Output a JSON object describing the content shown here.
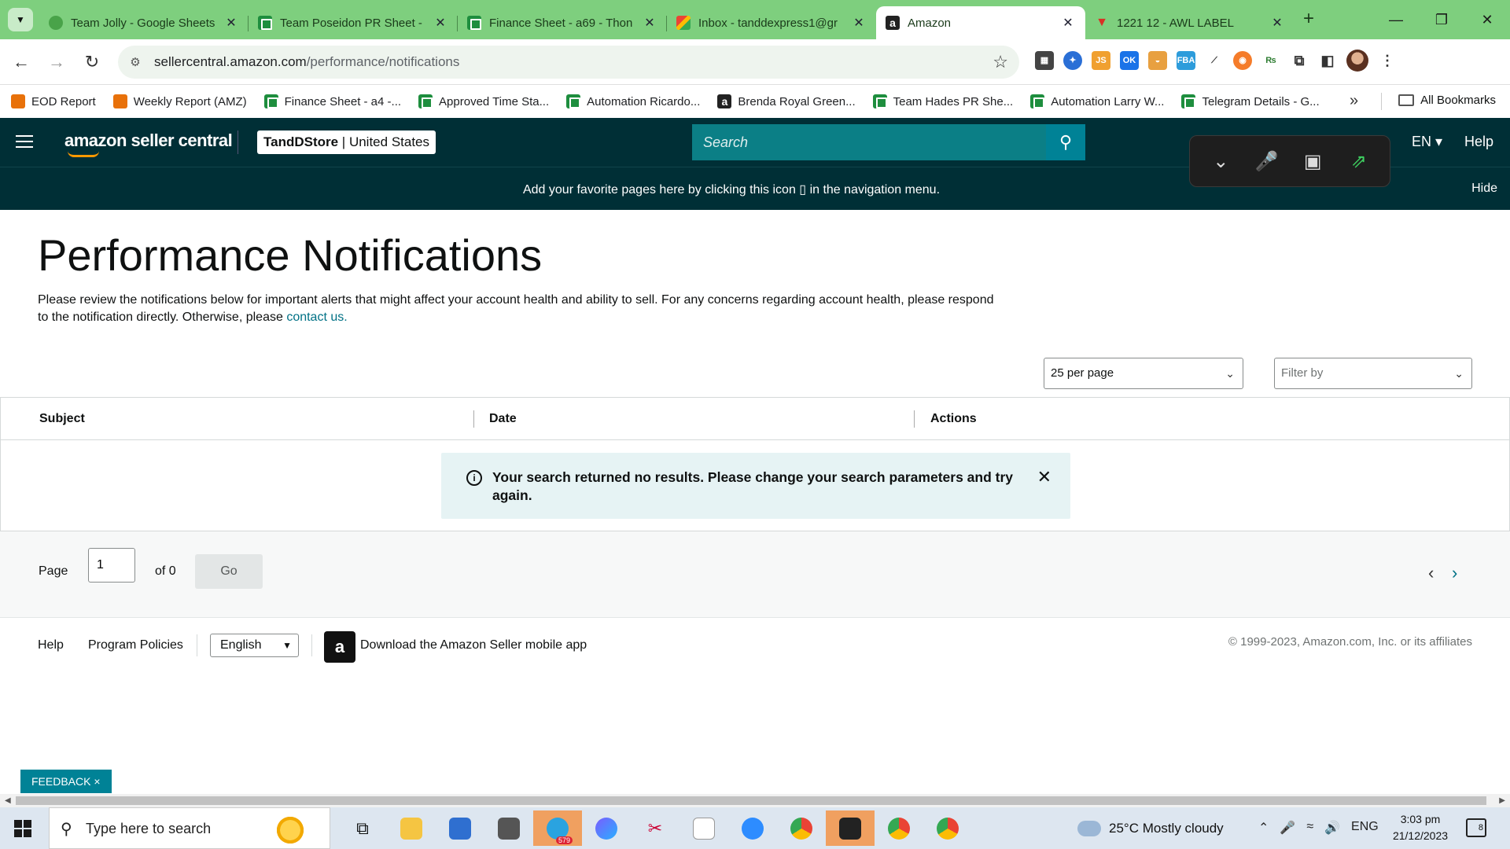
{
  "browser": {
    "tabs": [
      {
        "title": "Team Jolly - Google Sheets",
        "icon": "globe-icon"
      },
      {
        "title": "Team Poseidon PR Sheet -",
        "icon": "sheets-icon"
      },
      {
        "title": "Finance Sheet - a69 - Thon",
        "icon": "sheets-icon"
      },
      {
        "title": "Inbox - tanddexpress1@gr",
        "icon": "gmail-icon"
      },
      {
        "title": "Amazon",
        "icon": "amazon-icon",
        "active": true
      },
      {
        "title": "1221 12 - AWL LABEL",
        "icon": "awl-icon"
      }
    ],
    "url_domain": "sellercentral.amazon.com",
    "url_path": "/performance/notifications",
    "bookmarks": [
      {
        "label": "EOD Report",
        "icon": "pencil-icon"
      },
      {
        "label": "Weekly Report (AMZ)",
        "icon": "pencil-icon"
      },
      {
        "label": "Finance Sheet - a4 -...",
        "icon": "sheets-icon"
      },
      {
        "label": "Approved Time Sta...",
        "icon": "sheets-icon"
      },
      {
        "label": "Automation Ricardo...",
        "icon": "sheets-icon"
      },
      {
        "label": "Brenda Royal Green...",
        "icon": "amazon-icon"
      },
      {
        "label": "Team Hades PR She...",
        "icon": "sheets-icon"
      },
      {
        "label": "Automation Larry W...",
        "icon": "sheets-icon"
      },
      {
        "label": "Telegram Details - G...",
        "icon": "sheets-icon"
      }
    ],
    "all_bookmarks": "All Bookmarks"
  },
  "header": {
    "logo_text": "amazon seller central",
    "store_name": "TandDStore",
    "store_region": "United States",
    "search_placeholder": "Search",
    "language": "EN",
    "help": "Help"
  },
  "favorites_bar": {
    "message": "Add your favorite pages here by clicking this icon",
    "message_suffix": "in the navigation menu.",
    "hide": "Hide"
  },
  "main": {
    "title": "Performance Notifications",
    "description": "Please review the notifications below for important alerts that might affect your account health and ability to sell. For any concerns regarding account health, please respond to the notification directly. Otherwise, please",
    "contact_link": "contact us.",
    "per_page": "25 per page",
    "filter_placeholder": "Filter by",
    "columns": [
      "Subject",
      "Date",
      "Actions"
    ],
    "no_results": "Your search returned no results. Please change your search parameters and try again."
  },
  "pager": {
    "page_label": "Page",
    "page_value": "1",
    "of_label": "of 0",
    "go": "Go"
  },
  "footer": {
    "help": "Help",
    "policies": "Program Policies",
    "language": "English",
    "app_text": "Download the Amazon Seller mobile app",
    "copyright": "© 1999-2023, Amazon.com, Inc. or its affiliates"
  },
  "feedback": "FEEDBACK ×",
  "taskbar": {
    "search_placeholder": "Type here to search",
    "telegram_badge": "579",
    "weather": "25°C  Mostly cloudy",
    "lang": "ENG",
    "time": "3:03 pm",
    "date": "21/12/2023",
    "notifications": "8"
  },
  "colors": {
    "tabstrip": "#7ecf7e",
    "header": "#002f36",
    "link": "#007185",
    "alert_bg": "#e6f3f4",
    "feedback": "#008296"
  }
}
